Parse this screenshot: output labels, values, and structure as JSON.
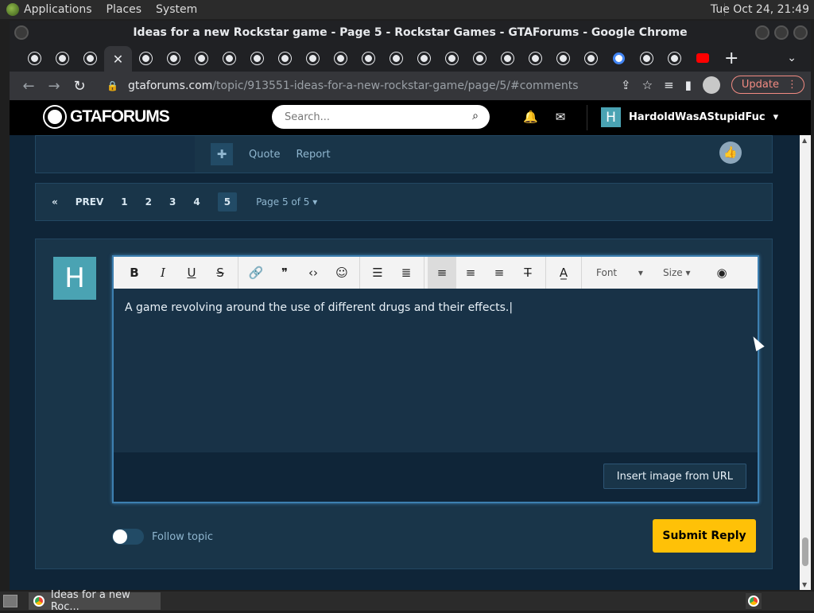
{
  "panel": {
    "menus": [
      "Applications",
      "Places",
      "System"
    ],
    "clock": "Tue Oct 24, 21:49"
  },
  "window": {
    "title": "Ideas for a new Rockstar game - Page 5 - Rockstar Games - GTAForums - Google Chrome"
  },
  "browser": {
    "url_host": "gtaforums.com",
    "url_path": "/topic/913551-ideas-for-a-new-rockstar-game/page/5/#comments",
    "update_label": "Update"
  },
  "site": {
    "logo_text": "GTAFORUMS",
    "search_placeholder": "Search...",
    "username": "HardoldWasAStupidFuc",
    "avatar_letter": "H"
  },
  "post_actions": {
    "quote": "Quote",
    "report": "Report"
  },
  "pagination": {
    "first": "«",
    "prev": "PREV",
    "pages": [
      "1",
      "2",
      "3",
      "4"
    ],
    "current": "5",
    "page_of": "Page 5 of 5 ▾"
  },
  "reply": {
    "avatar_letter": "H",
    "text": "A game revolving around the use of different drugs and their effects.",
    "toolbar": {
      "bold": "B",
      "italic": "I",
      "underline": "U",
      "strike": "S",
      "font": "Font",
      "size": "Size"
    },
    "insert_image": "Insert image from URL",
    "follow_label": "Follow topic",
    "submit": "Submit Reply"
  },
  "taskbar": {
    "task_title": "Ideas for a new Roc..."
  }
}
